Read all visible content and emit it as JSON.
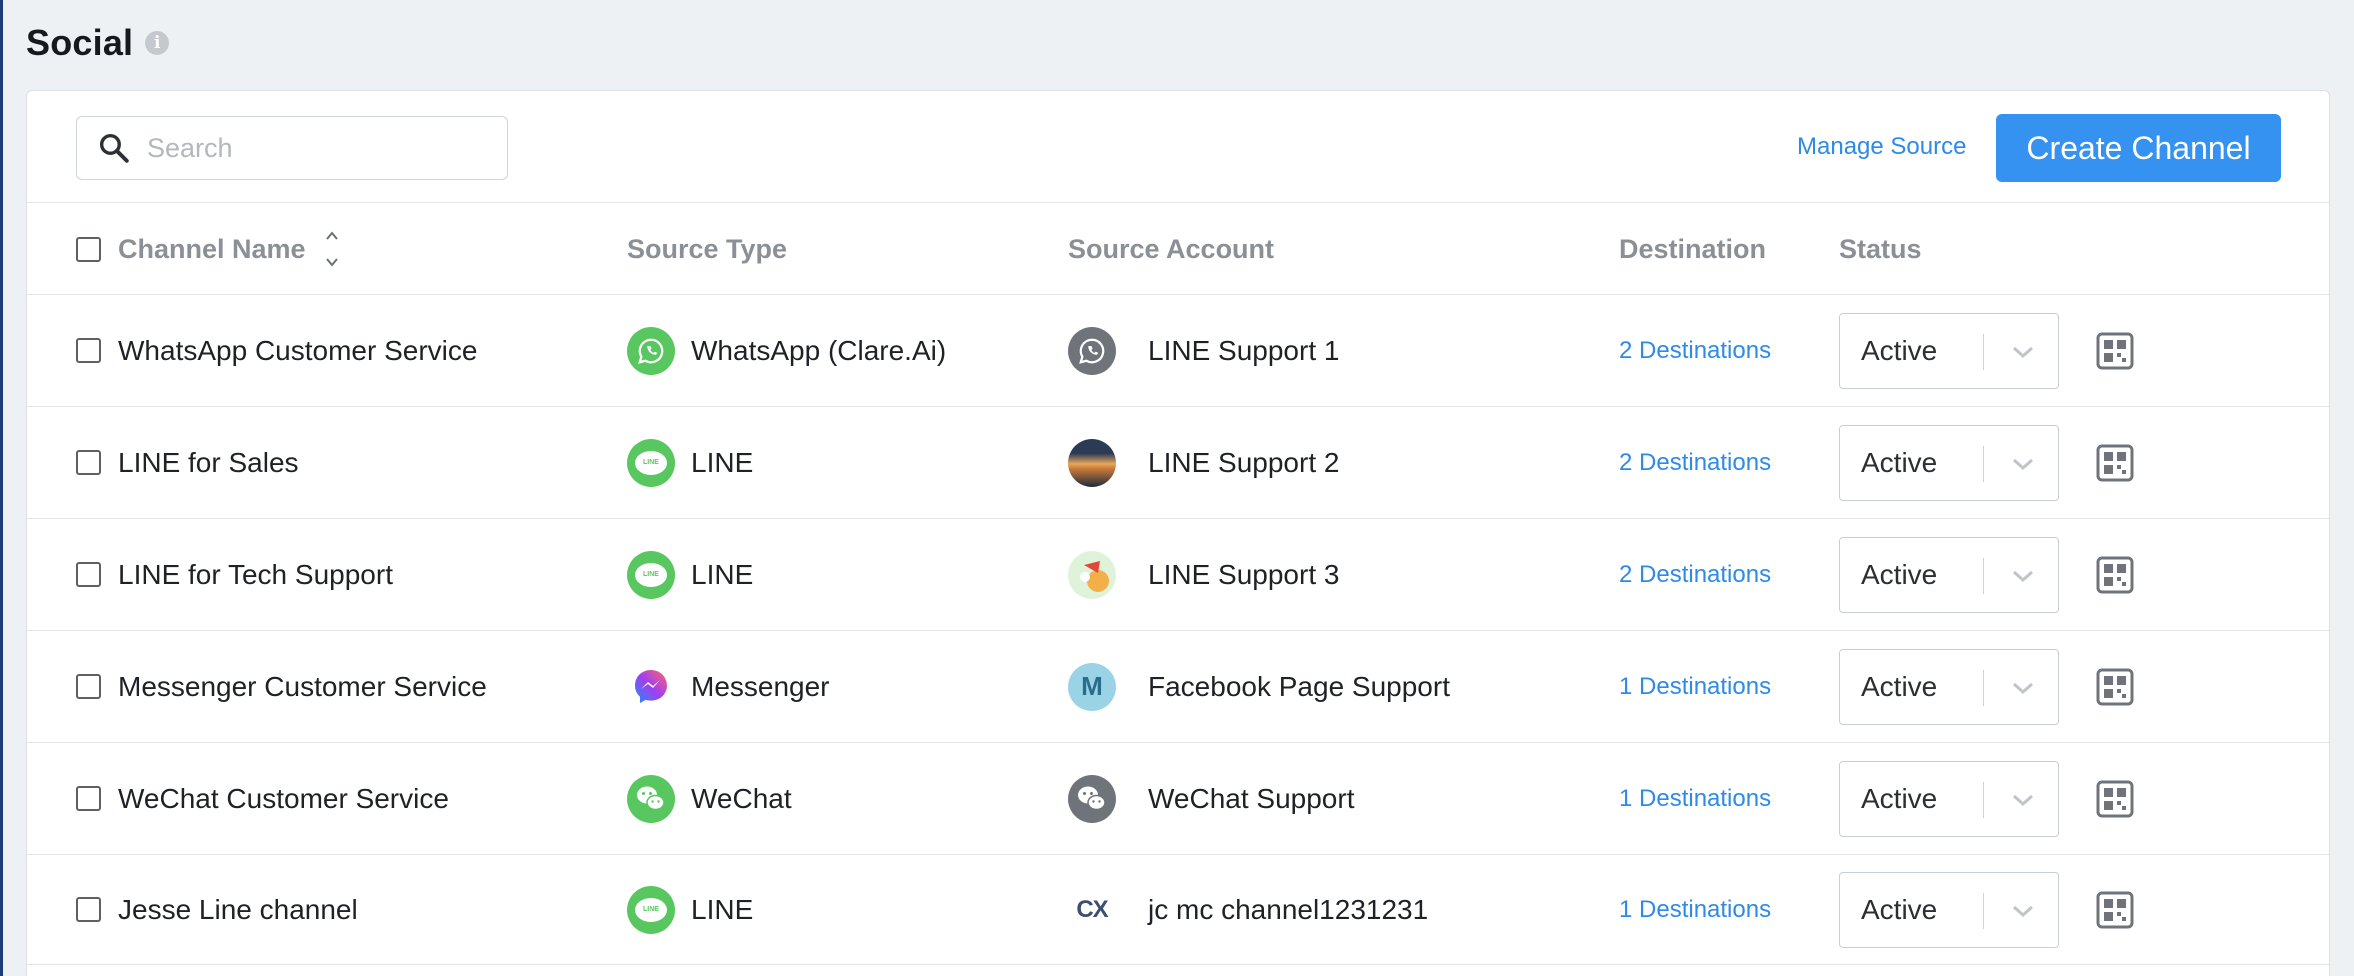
{
  "page": {
    "title": "Social",
    "info_icon": "info-icon"
  },
  "toolbar": {
    "search_placeholder": "Search",
    "manage_source_label": "Manage Source",
    "create_channel_label": "Create Channel"
  },
  "columns": {
    "channel_name": "Channel Name",
    "source_type": "Source Type",
    "source_account": "Source Account",
    "destination": "Destination",
    "status": "Status"
  },
  "colors": {
    "accent": "#3592f0",
    "link": "#2f8ae6",
    "green": "#58c760",
    "gray_icon": "#6e7479"
  },
  "rows": [
    {
      "name": "WhatsApp Customer Service",
      "source_type": "WhatsApp (Clare.Ai)",
      "source_icon": "whatsapp-icon",
      "account": "LINE Support 1",
      "account_icon": "whatsapp-gray-avatar",
      "destinations": "2 Destinations",
      "status": "Active"
    },
    {
      "name": "LINE for Sales",
      "source_type": "LINE",
      "source_icon": "line-icon",
      "account": "LINE Support 2",
      "account_icon": "sunset-photo-avatar",
      "destinations": "2 Destinations",
      "status": "Active"
    },
    {
      "name": "LINE for Tech Support",
      "source_type": "LINE",
      "source_icon": "line-icon",
      "account": "LINE Support 3",
      "account_icon": "cartoon-avatar",
      "destinations": "2 Destinations",
      "status": "Active"
    },
    {
      "name": "Messenger Customer Service",
      "source_type": "Messenger",
      "source_icon": "messenger-icon",
      "account": "Facebook Page Support",
      "account_icon": "letter-m-avatar",
      "account_letter": "M",
      "destinations": "1 Destinations",
      "status": "Active"
    },
    {
      "name": "WeChat Customer Service",
      "source_type": "WeChat",
      "source_icon": "wechat-icon",
      "account": "WeChat Support",
      "account_icon": "wechat-gray-avatar",
      "destinations": "1 Destinations",
      "status": "Active"
    },
    {
      "name": "Jesse Line channel",
      "source_type": "LINE",
      "source_icon": "line-icon",
      "account": "jc mc channel1231231",
      "account_icon": "cx-logo-avatar",
      "account_logo_text": "CX",
      "destinations": "1 Destinations",
      "status": "Active"
    }
  ]
}
